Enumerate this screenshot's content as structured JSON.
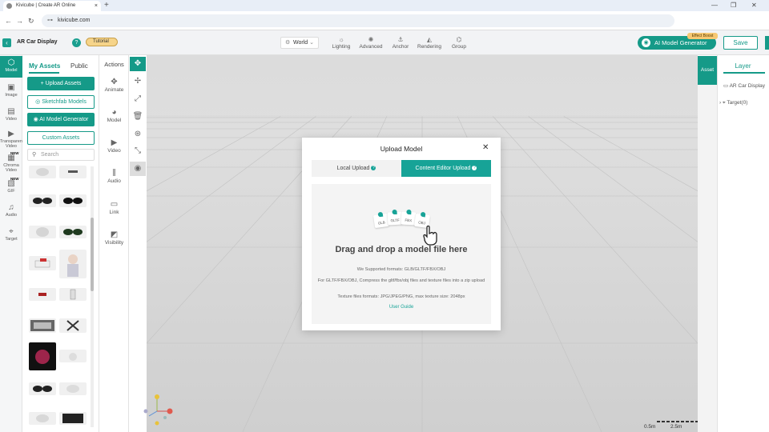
{
  "browser": {
    "tab_title": "Kivicube | Create AR Online",
    "tab_close": "×",
    "new_tab": "+",
    "url": "kivicube.com",
    "back": "←",
    "forward": "→",
    "reload": "↻",
    "site_info": "⊶",
    "minimize": "—",
    "restore": "❐",
    "close": "✕"
  },
  "header": {
    "back": "‹",
    "project_name": "AR Car Display",
    "help": "?",
    "tutorial": "Tutorial",
    "world_select": "World",
    "tools": [
      {
        "label": "Lighting",
        "icon": "lighting-icon",
        "glyph": "☼"
      },
      {
        "label": "Advanced",
        "icon": "advanced-icon",
        "glyph": "✺"
      },
      {
        "label": "Anchor",
        "icon": "anchor-icon",
        "glyph": "⚓"
      },
      {
        "label": "Rendering",
        "icon": "rendering-icon",
        "glyph": "◭"
      },
      {
        "label": "Group",
        "icon": "group-icon",
        "glyph": "⌬"
      }
    ],
    "ai_generator": "AI Model Generator",
    "boost_badge": "Effect Boost",
    "save": "Save"
  },
  "rail": [
    {
      "label": "Model",
      "icon": "model-icon",
      "glyph": "⬡",
      "active": true
    },
    {
      "label": "Image",
      "icon": "image-icon",
      "glyph": "▣"
    },
    {
      "label": "Video",
      "icon": "video-icon",
      "glyph": "▤"
    },
    {
      "label": "Transparent Video",
      "icon": "transparent-video-icon",
      "glyph": "▶"
    },
    {
      "label": "Chroma Video",
      "icon": "chroma-video-icon",
      "glyph": "▦",
      "badge": "NEW"
    },
    {
      "label": "GIF",
      "icon": "gif-icon",
      "glyph": "▧",
      "badge": "NEW"
    },
    {
      "label": "Audio",
      "icon": "audio-icon",
      "glyph": "♫"
    },
    {
      "label": "Target",
      "icon": "target-icon",
      "glyph": "⌖"
    }
  ],
  "assets": {
    "tab_my": "My Assets",
    "tab_public": "Public",
    "upload": "+ Upload Assets",
    "sketchfab": "Sketchfab Models",
    "ai_generator": "AI Model Generator",
    "custom": "Custom Assets",
    "search_placeholder": "Search"
  },
  "actions": {
    "title": "Actions",
    "items": [
      {
        "label": "Animate",
        "icon": "animate-icon",
        "glyph": "✥"
      },
      {
        "label": "Model",
        "icon": "model-action-icon",
        "glyph": "◕"
      },
      {
        "label": "Video",
        "icon": "video-action-icon",
        "glyph": "▶"
      },
      {
        "label": "Audio",
        "icon": "audio-action-icon",
        "glyph": "⫼"
      },
      {
        "label": "Link",
        "icon": "link-icon",
        "glyph": "▭"
      },
      {
        "label": "Visibility",
        "icon": "visibility-icon",
        "glyph": "◩"
      }
    ]
  },
  "right": {
    "asset_tab": "Asset",
    "layer_title": "Layer",
    "layer_items": [
      "AR Car Display",
      "Target(0)"
    ]
  },
  "scale": {
    "a": "0.5m",
    "b": "2.5m"
  },
  "modal": {
    "title": "Upload Model",
    "close": "✕",
    "tab_local": "Local Upload",
    "tab_content": "Content Editor Upload",
    "formats": [
      "GLB",
      "GLTF",
      "FBX",
      "OBJ"
    ],
    "drag_title": "Drag and drop a model file here",
    "supported": "We Supported formats: GLB/GLTF/FBX/OBJ",
    "compress": "For GLTF/FBX/OBJ, Compress the gltf/fbx/obj files and texture files into a zip upload",
    "texture": "Texture files formats: JPG/JPEG/PNG, max texture size: 2048px",
    "user_guide": "User Guide"
  },
  "colors": {
    "accent": "#159a88",
    "tutorial": "#f6d48a"
  }
}
